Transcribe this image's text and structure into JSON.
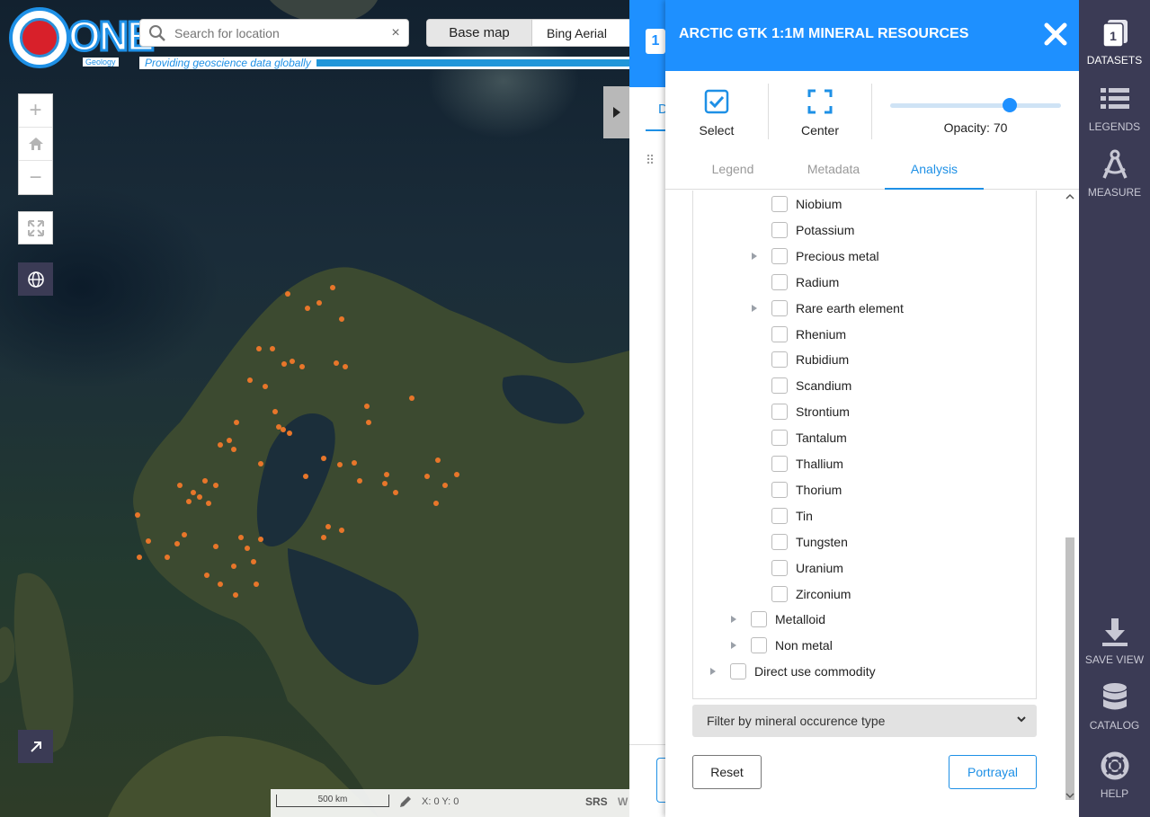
{
  "app": {
    "logo_text": "ONE",
    "logo_sub": "Geology",
    "tagline": "Providing geoscience data globally"
  },
  "search": {
    "placeholder": "Search for location",
    "clear_symbol": "×"
  },
  "basemap": {
    "label": "Base map",
    "value": "Bing Aerial"
  },
  "map_controls": {
    "zoom_in": "+",
    "zoom_out": "−"
  },
  "status": {
    "scale_label": "500 km",
    "coords": "X: 0 Y: 0",
    "srs": "SRS",
    "srs_trunc": "W"
  },
  "back_panel": {
    "badge": "1",
    "tab_initial": "D"
  },
  "dialog": {
    "title": "ARCTIC GTK 1:1M MINERAL RESOURCES",
    "tools": {
      "select": "Select",
      "center": "Center",
      "opacity_label": "Opacity: 70",
      "opacity_value": 70
    },
    "tabs": [
      {
        "label": "Legend",
        "active": false
      },
      {
        "label": "Metadata",
        "active": false
      },
      {
        "label": "Analysis",
        "active": true
      }
    ],
    "tree": [
      {
        "label": "Niobium",
        "level": 2,
        "expandable": false
      },
      {
        "label": "Potassium",
        "level": 2,
        "expandable": false
      },
      {
        "label": "Precious metal",
        "level": 2,
        "expandable": true
      },
      {
        "label": "Radium",
        "level": 2,
        "expandable": false
      },
      {
        "label": "Rare earth element",
        "level": 2,
        "expandable": true
      },
      {
        "label": "Rhenium",
        "level": 2,
        "expandable": false
      },
      {
        "label": "Rubidium",
        "level": 2,
        "expandable": false
      },
      {
        "label": "Scandium",
        "level": 2,
        "expandable": false
      },
      {
        "label": "Strontium",
        "level": 2,
        "expandable": false
      },
      {
        "label": "Tantalum",
        "level": 2,
        "expandable": false
      },
      {
        "label": "Thallium",
        "level": 2,
        "expandable": false
      },
      {
        "label": "Thorium",
        "level": 2,
        "expandable": false
      },
      {
        "label": "Tin",
        "level": 2,
        "expandable": false
      },
      {
        "label": "Tungsten",
        "level": 2,
        "expandable": false
      },
      {
        "label": "Uranium",
        "level": 2,
        "expandable": false
      },
      {
        "label": "Zirconium",
        "level": 2,
        "expandable": false
      },
      {
        "label": "Metalloid",
        "level": 1,
        "expandable": true
      },
      {
        "label": "Non metal",
        "level": 1,
        "expandable": true
      },
      {
        "label": "Direct use commodity",
        "level": 0,
        "expandable": true
      }
    ],
    "filter_label": "Filter by mineral occurence type",
    "reset_label": "Reset",
    "portrayal_label": "Portrayal"
  },
  "sidebar": {
    "datasets_count": "1",
    "items": [
      {
        "label": "DATASETS",
        "icon": "datasets-icon",
        "active": true
      },
      {
        "label": "LEGENDS",
        "icon": "list-icon",
        "active": false
      },
      {
        "label": "MEASURE",
        "icon": "compass-icon",
        "active": false
      },
      {
        "label": "SAVE VIEW",
        "icon": "download-icon",
        "active": false
      },
      {
        "label": "CATALOG",
        "icon": "database-icon",
        "active": false
      },
      {
        "label": "HELP",
        "icon": "lifebuoy-icon",
        "active": false
      }
    ]
  },
  "colors": {
    "accent": "#1e90ff",
    "sidebar": "#3b3b55",
    "mineral_points": "#e8762a"
  }
}
